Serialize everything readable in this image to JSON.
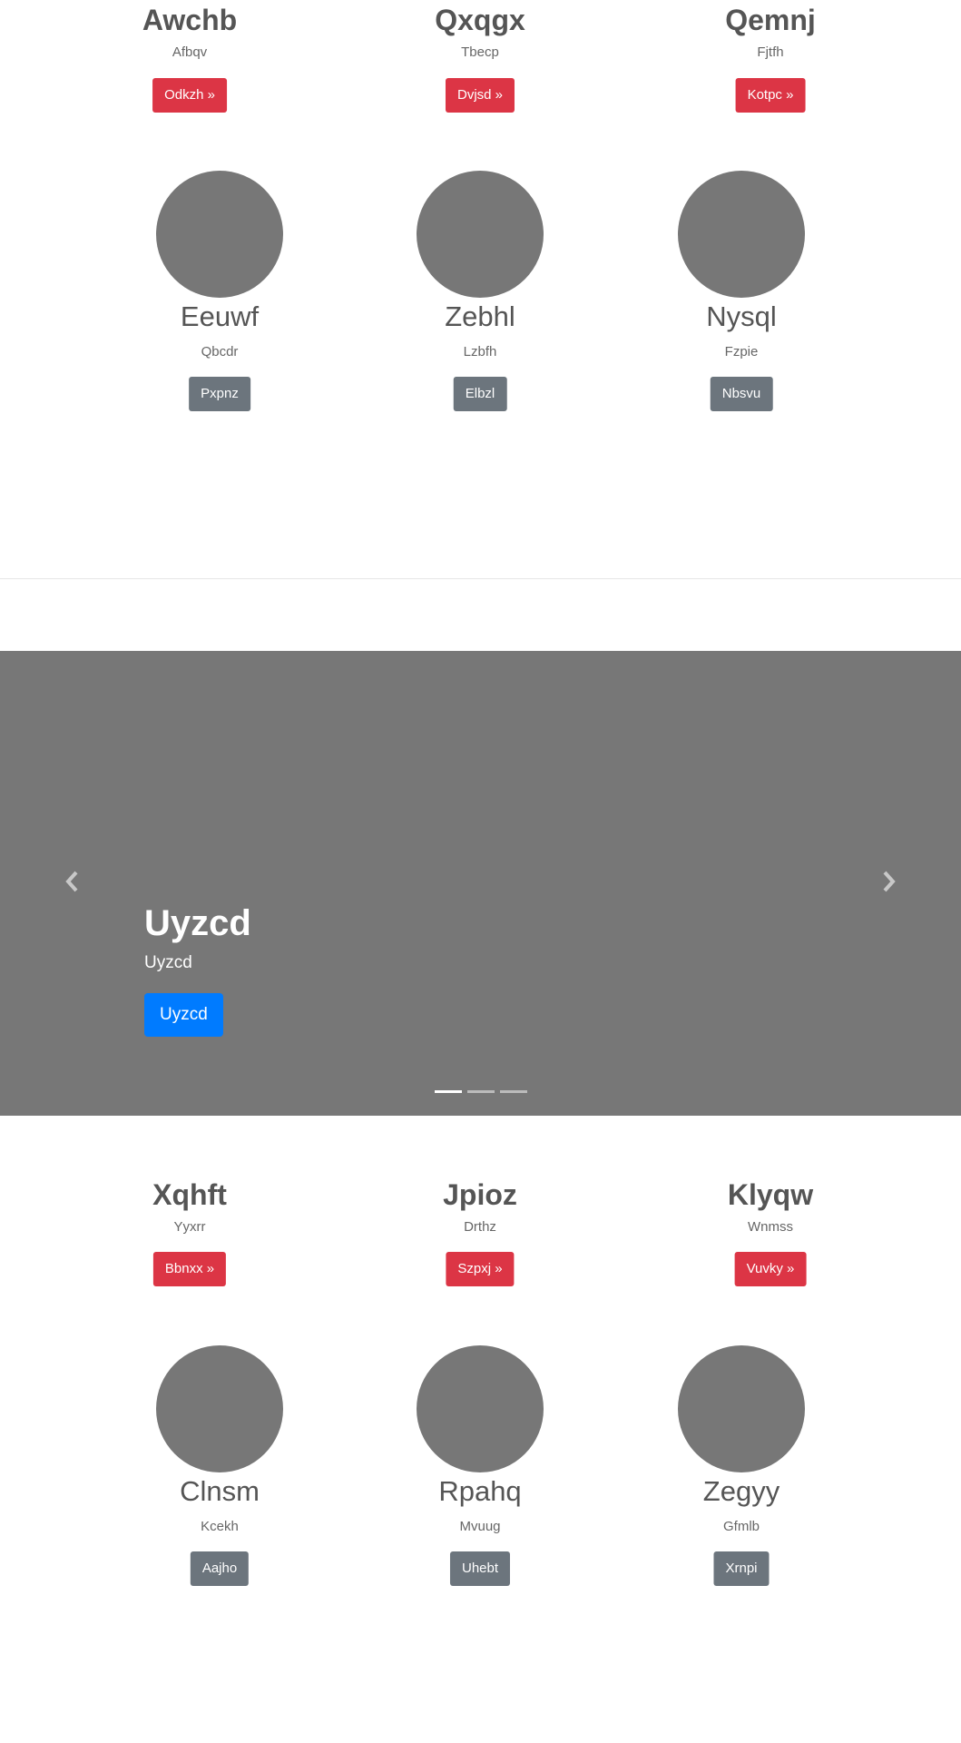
{
  "features_top": [
    {
      "title": "Awchb",
      "subtitle": "Afbqv",
      "button": "Odkzh »"
    },
    {
      "title": "Qxqgx",
      "subtitle": "Tbecp",
      "button": "Dvjsd »"
    },
    {
      "title": "Qemnj",
      "subtitle": "Fjtfh",
      "button": "Kotpc »"
    }
  ],
  "team_top": [
    {
      "name": "Eeuwf",
      "subtitle": "Qbcdr",
      "button": "Pxpnz"
    },
    {
      "name": "Zebhl",
      "subtitle": "Lzbfh",
      "button": "Elbzl"
    },
    {
      "name": "Nysql",
      "subtitle": "Fzpie",
      "button": "Nbsvu"
    }
  ],
  "carousel": {
    "title": "Uyzcd",
    "subtitle": "Uyzcd",
    "button": "Uyzcd",
    "prev_icon": "chevron-left-icon",
    "next_icon": "chevron-right-icon",
    "slide_count": 3,
    "active_index": 0
  },
  "features_bottom": [
    {
      "title": "Xqhft",
      "subtitle": "Yyxrr",
      "button": "Bbnxx »"
    },
    {
      "title": "Jpioz",
      "subtitle": "Drthz",
      "button": "Szpxj »"
    },
    {
      "title": "Klyqw",
      "subtitle": "Wnmss",
      "button": "Vuvky »"
    }
  ],
  "team_bottom": [
    {
      "name": "Clnsm",
      "subtitle": "Kcekh",
      "button": "Aajho"
    },
    {
      "name": "Rpahq",
      "subtitle": "Mvuug",
      "button": "Uhebt"
    },
    {
      "name": "Zegyy",
      "subtitle": "Gfmlb",
      "button": "Xrnpi"
    }
  ],
  "colors": {
    "danger": "#dc3545",
    "secondary": "#6c757d",
    "primary": "#007bff",
    "placeholder": "#777777"
  }
}
